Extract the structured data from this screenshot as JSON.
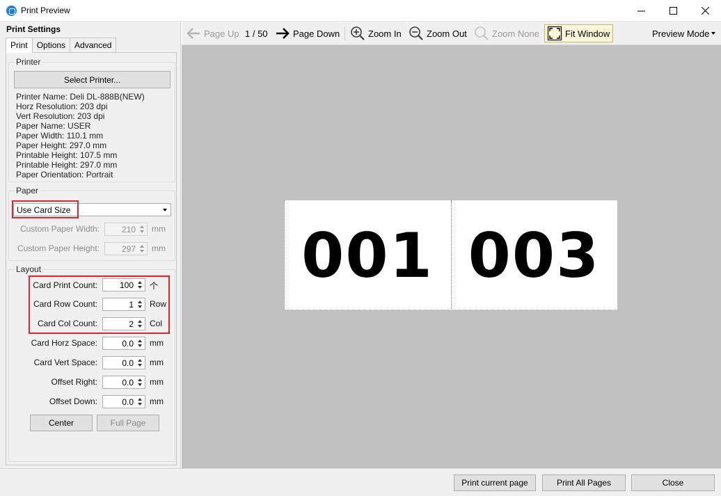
{
  "window": {
    "title": "Print Preview"
  },
  "left": {
    "header": "Print Settings",
    "tabs": [
      {
        "label": "Print",
        "active": true
      },
      {
        "label": "Options",
        "active": false
      },
      {
        "label": "Advanced",
        "active": false
      }
    ],
    "printer": {
      "title": "Printer",
      "select_label": "Select Printer...",
      "info": [
        "Printer Name: Deli DL-888B(NEW)",
        "Horz Resolution: 203 dpi",
        "Vert Resolution: 203 dpi",
        "Paper Name: USER",
        "Paper Width: 110.1 mm",
        "Paper Height: 297.0 mm",
        "Printable Height: 107.5 mm",
        "Printable Height: 297.0 mm",
        "Paper Orientation: Portrait"
      ]
    },
    "paper": {
      "title": "Paper",
      "size_value": "Use Card Size",
      "custom_width_label": "Custom Paper Width:",
      "custom_width_value": "210",
      "custom_height_label": "Custom Paper Height:",
      "custom_height_value": "297",
      "unit": "mm"
    },
    "layout": {
      "title": "Layout",
      "rows": [
        {
          "label": "Card Print Count:",
          "value": "100",
          "unit": "个"
        },
        {
          "label": "Card Row Count:",
          "value": "1",
          "unit": "Row"
        },
        {
          "label": "Card Col Count:",
          "value": "2",
          "unit": "Col"
        },
        {
          "label": "Card Horz Space:",
          "value": "0.0",
          "unit": "mm"
        },
        {
          "label": "Card Vert Space:",
          "value": "0.0",
          "unit": "mm"
        },
        {
          "label": "Offset Right:",
          "value": "0.0",
          "unit": "mm"
        },
        {
          "label": "Offset Down:",
          "value": "0.0",
          "unit": "mm"
        }
      ],
      "center_label": "Center",
      "full_page_label": "Full Page"
    }
  },
  "toolbar": {
    "page_up": "Page Up",
    "page_indicator": "1 / 50",
    "page_down": "Page Down",
    "zoom_in": "Zoom In",
    "zoom_out": "Zoom Out",
    "zoom_none": "Zoom None",
    "fit_window": "Fit Window",
    "preview_mode": "Preview Mode"
  },
  "preview": {
    "cards": [
      "001",
      "003"
    ]
  },
  "bottom": {
    "print_current": "Print current page",
    "print_all": "Print All Pages",
    "close": "Close"
  },
  "colors": {
    "highlight": "#e0242b",
    "preview_bg": "#c0c0c0",
    "accent": "#1a7fe0"
  }
}
